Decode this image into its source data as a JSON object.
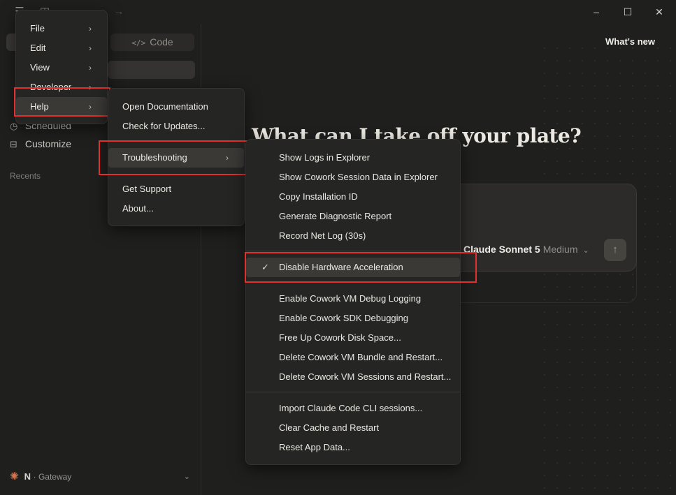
{
  "window": {
    "minimize_icon": "minimize-icon",
    "maximize_icon": "maximize-icon",
    "close_icon": "close-icon"
  },
  "sidebar": {
    "mode_tabs": {
      "code_label": "Code"
    },
    "nav_items": [
      {
        "label": "Scheduled",
        "icon": "clock-icon"
      },
      {
        "label": "Customize",
        "icon": "briefcase-icon"
      }
    ],
    "recents_label": "Recents",
    "account": {
      "initial": "N",
      "separator": "·",
      "name": "Gateway"
    }
  },
  "main": {
    "whats_new": "What's new",
    "heading": "What can I take off your plate?",
    "model": {
      "name": "Claude Sonnet 5",
      "effort": "Medium"
    }
  },
  "menus": {
    "top": [
      "File",
      "Edit",
      "View",
      "Developer",
      "Help"
    ],
    "help": {
      "items": [
        "Open Documentation",
        "Check for Updates...",
        "Troubleshooting",
        "Get Support",
        "About..."
      ]
    },
    "troubleshooting": {
      "group1": [
        "Show Logs in Explorer",
        "Show Cowork Session Data in Explorer",
        "Copy Installation ID",
        "Generate Diagnostic Report",
        "Record Net Log (30s)"
      ],
      "checked": "Disable Hardware Acceleration",
      "group2": [
        "Enable Cowork VM Debug Logging",
        "Enable Cowork SDK Debugging",
        "Free Up Cowork Disk Space...",
        "Delete Cowork VM Bundle and Restart...",
        "Delete Cowork VM Sessions and Restart..."
      ],
      "group3": [
        "Import Claude Code CLI sessions...",
        "Clear Cache and Restart",
        "Reset App Data..."
      ]
    }
  },
  "colors": {
    "highlight_border": "#e0302f",
    "accent": "#d8744c"
  }
}
